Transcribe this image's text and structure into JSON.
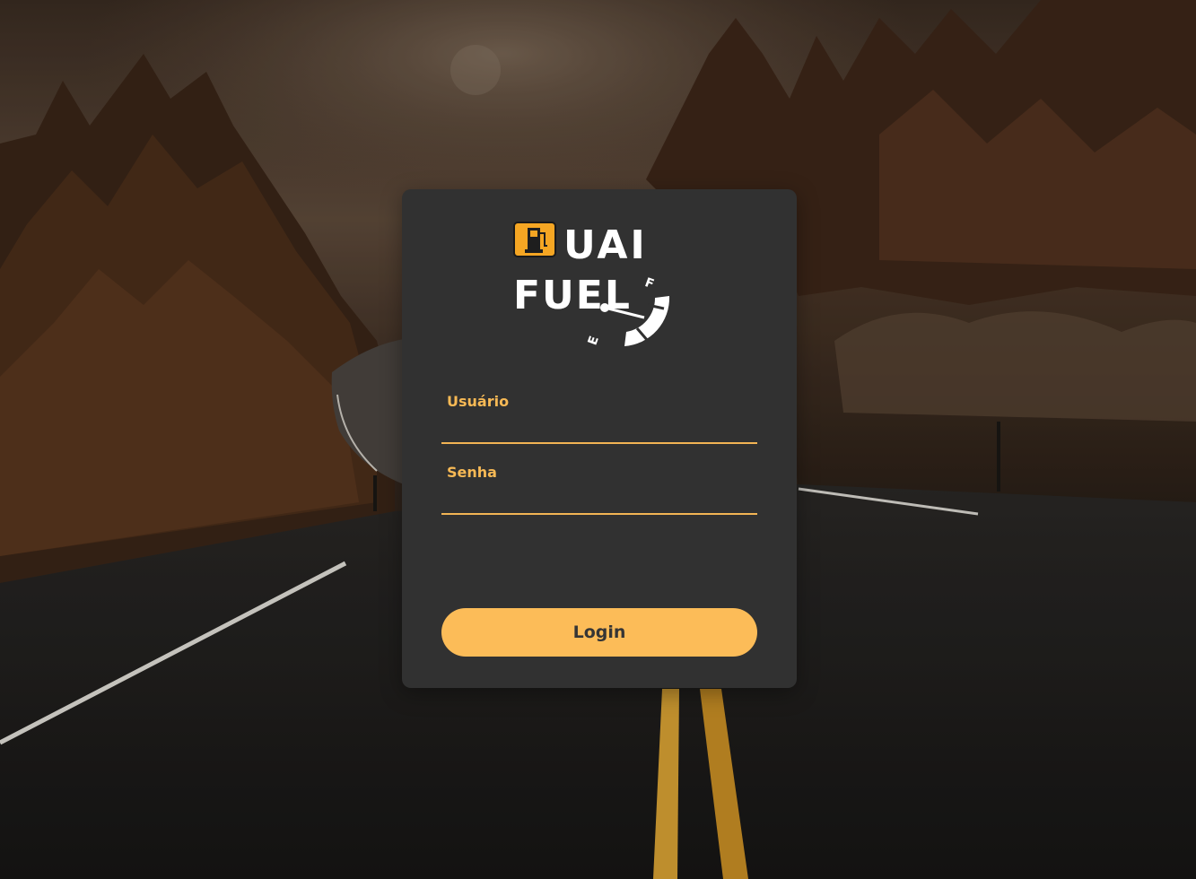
{
  "background": {
    "description": "road-forest-photo",
    "accent": "#fcbc58"
  },
  "logo": {
    "line1": "UAI",
    "line2": "FUEL",
    "gauge_full": "F",
    "gauge_empty": "E",
    "icon": "fuel-pump-icon",
    "icon_color": "#f5a623"
  },
  "form": {
    "username_label": "Usuário",
    "username_value": "",
    "password_label": "Senha",
    "password_value": "",
    "login_label": "Login"
  },
  "colors": {
    "card": "#313131",
    "label": "#f7b955",
    "underline": "#f2b454",
    "button": "#fcbc58",
    "button_text": "#353535"
  }
}
